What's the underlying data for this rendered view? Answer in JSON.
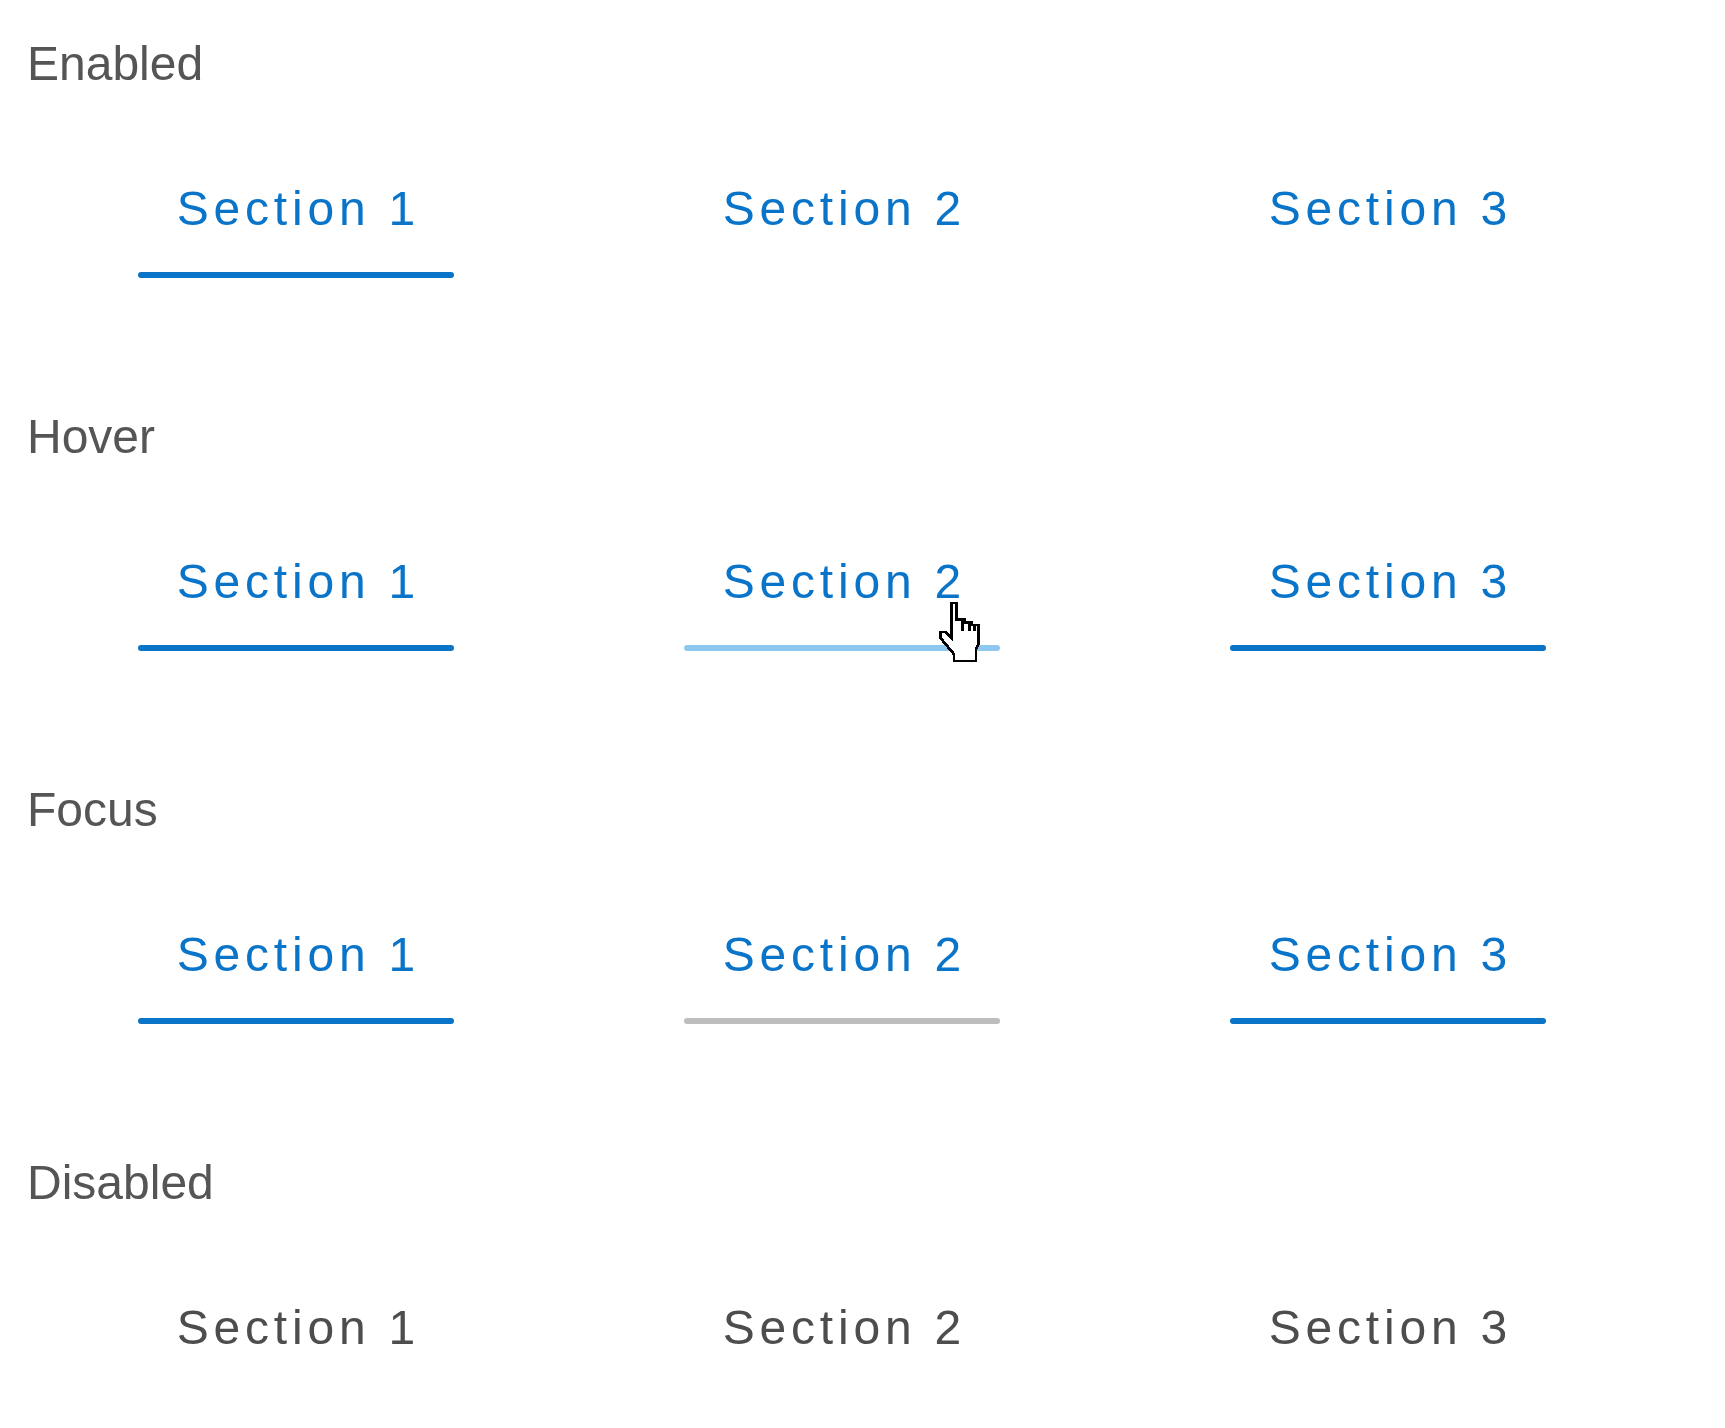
{
  "groups": [
    {
      "title": "Enabled",
      "disabled": false,
      "tabs": [
        {
          "label": "Section 1",
          "selected": true,
          "hovered": false,
          "focused": false
        },
        {
          "label": "Section 2",
          "selected": false,
          "hovered": false,
          "focused": false
        },
        {
          "label": "Section 3",
          "selected": false,
          "hovered": false,
          "focused": false
        }
      ]
    },
    {
      "title": "Hover",
      "disabled": false,
      "tabs": [
        {
          "label": "Section 1",
          "selected": true,
          "hovered": false,
          "focused": false
        },
        {
          "label": "Section 2",
          "selected": false,
          "hovered": true,
          "focused": false
        },
        {
          "label": "Section 3",
          "selected": true,
          "hovered": false,
          "focused": false
        }
      ]
    },
    {
      "title": "Focus",
      "disabled": false,
      "tabs": [
        {
          "label": "Section 1",
          "selected": true,
          "hovered": false,
          "focused": false
        },
        {
          "label": "Section 2",
          "selected": false,
          "hovered": false,
          "focused": true
        },
        {
          "label": "Section 3",
          "selected": true,
          "hovered": false,
          "focused": false
        }
      ]
    },
    {
      "title": "Disabled",
      "disabled": true,
      "tabs": [
        {
          "label": "Section 1",
          "selected": false,
          "hovered": false,
          "focused": false
        },
        {
          "label": "Section 2",
          "selected": false,
          "hovered": false,
          "focused": false
        },
        {
          "label": "Section 3",
          "selected": false,
          "hovered": false,
          "focused": false
        }
      ]
    }
  ]
}
